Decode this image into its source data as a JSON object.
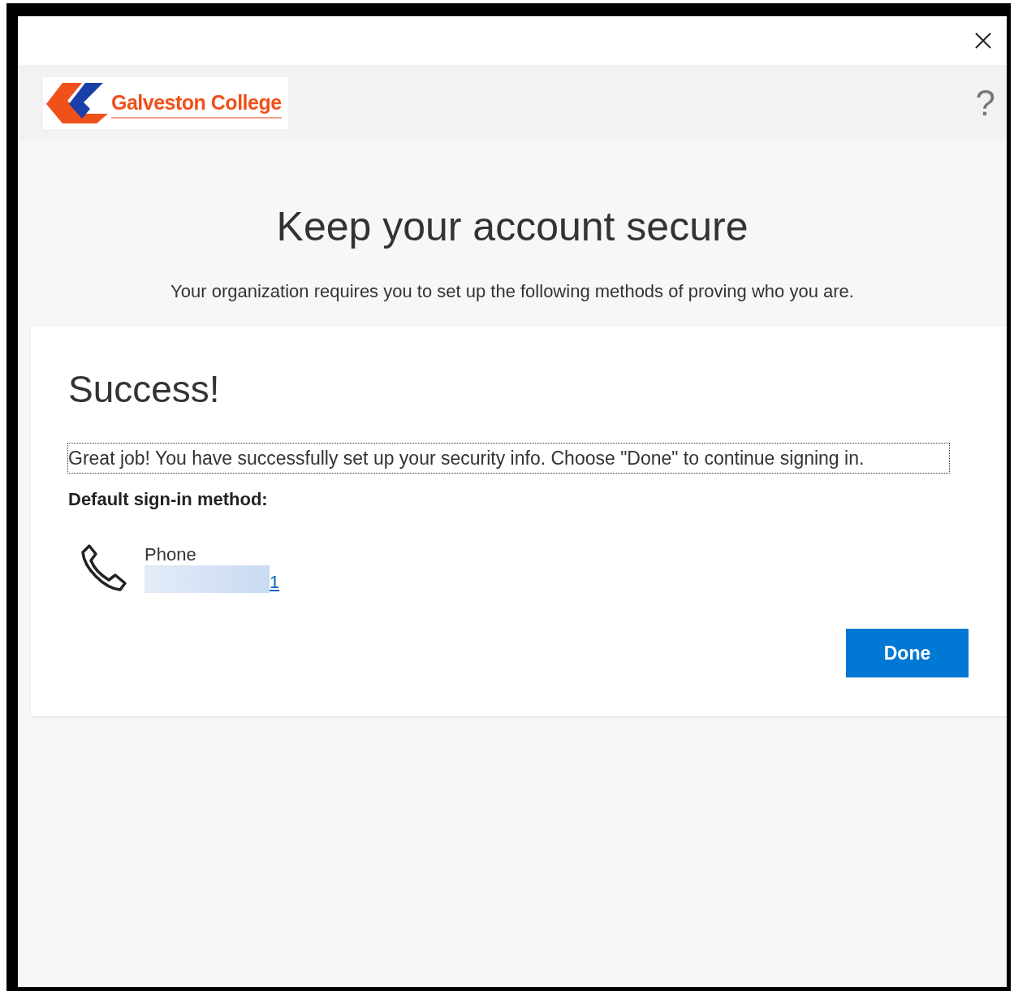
{
  "logo": {
    "text": "Galveston College"
  },
  "help": {
    "label": "?"
  },
  "title": "Keep your account secure",
  "subtitle": "Your organization requires you to set up the following methods of proving who you are.",
  "card": {
    "heading": "Success!",
    "message": "Great job! You have successfully set up your security info. Choose \"Done\" to continue signing in.",
    "default_label": "Default sign-in method:",
    "method": {
      "kind": "phone",
      "name": "Phone",
      "detail": "1"
    },
    "button": "Done"
  }
}
